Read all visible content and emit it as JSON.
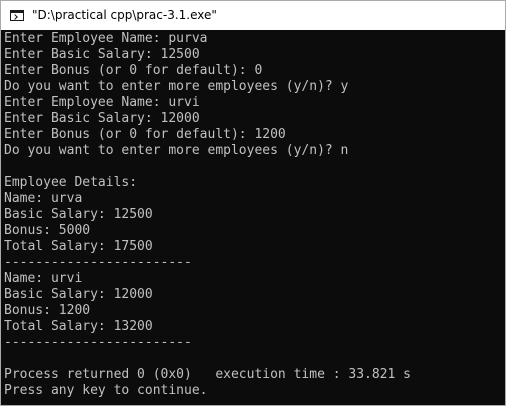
{
  "window": {
    "title": "\"D:\\practical cpp\\prac-3.1.exe\"",
    "icon": "console-app-icon"
  },
  "console": {
    "background": "#0c0c0c",
    "foreground": "#c0c0c0",
    "lines": [
      "Enter Employee Name: purva",
      "Enter Basic Salary: 12500",
      "Enter Bonus (or 0 for default): 0",
      "Do you want to enter more employees (y/n)? y",
      "Enter Employee Name: urvi",
      "Enter Basic Salary: 12000",
      "Enter Bonus (or 0 for default): 1200",
      "Do you want to enter more employees (y/n)? n",
      "",
      "Employee Details:",
      "Name: urva",
      "Basic Salary: 12500",
      "Bonus: 5000",
      "Total Salary: 17500",
      "------------------------",
      "Name: urvi",
      "Basic Salary: 12000",
      "Bonus: 1200",
      "Total Salary: 13200",
      "------------------------",
      "",
      "Process returned 0 (0x0)   execution time : 33.821 s",
      "Press any key to continue."
    ]
  }
}
